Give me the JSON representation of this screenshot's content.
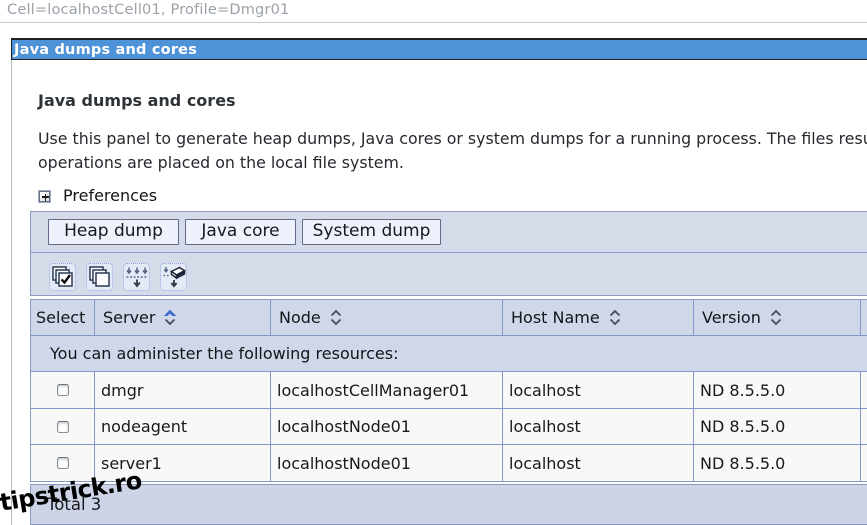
{
  "breadcrumb": {
    "text": "Cell=localhostCell01, Profile=Dmgr01"
  },
  "titlebar": {
    "title": "Java dumps and cores"
  },
  "content": {
    "heading": "Java dumps and cores",
    "description_line1": "Use this panel to generate heap dumps, Java cores or system dumps for a running process. The files resulting from these",
    "description_line2": "operations are placed on the local file system.",
    "preferences_label": "Preferences"
  },
  "toolbar": {
    "buttons": [
      {
        "label": "Heap dump"
      },
      {
        "label": "Java core"
      },
      {
        "label": "System dump"
      }
    ],
    "icons": [
      {
        "name": "select-all-items"
      },
      {
        "name": "deselect-all-items"
      },
      {
        "name": "show-filter-function"
      },
      {
        "name": "clear-filter-value"
      }
    ]
  },
  "table": {
    "columns": [
      {
        "label": "Select",
        "sortable": false
      },
      {
        "label": "Server",
        "sortable": true,
        "sort": "ascending"
      },
      {
        "label": "Node",
        "sortable": true,
        "sort": "none"
      },
      {
        "label": "Host Name",
        "sortable": true,
        "sort": "none"
      },
      {
        "label": "Version",
        "sortable": true,
        "sort": "none"
      }
    ],
    "info_row": "You can administer the following resources:",
    "rows": [
      {
        "server": "dmgr",
        "node": "localhostCellManager01",
        "host_name": "localhost",
        "version": "ND 8.5.5.0"
      },
      {
        "server": "nodeagent",
        "node": "localhostNode01",
        "host_name": "localhost",
        "version": "ND 8.5.5.0"
      },
      {
        "server": "server1",
        "node": "localhostNode01",
        "host_name": "localhost",
        "version": "ND 8.5.5.0"
      }
    ],
    "footer_total": "Total 3"
  },
  "watermark": {
    "text": "tipstrick.ro"
  },
  "colors": {
    "titlebar_bg": "#4e92d7",
    "toolbar_bg": "#d5dbe9",
    "header_bg": "#cfd7e9",
    "row_bg": "#f8f8f7",
    "footer_bg": "#ccd4e6",
    "grid_line": "#8497ce",
    "outer_border": "#8c9ac1",
    "button_bg": "#eef0fb",
    "button_border": "#5f6b89",
    "breadcrumb_text": "#9aa1a9",
    "sort_active": "#3a68c8",
    "sort_inactive": "#4a4d52"
  }
}
